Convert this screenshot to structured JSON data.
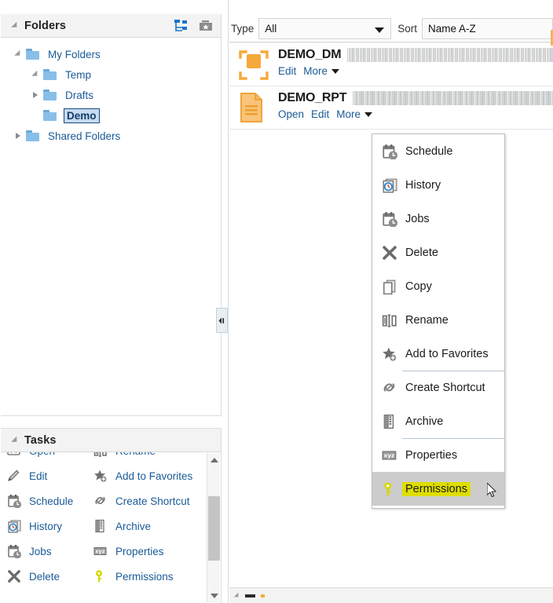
{
  "folders_panel": {
    "title": "Folders",
    "disclosure_icon": "triangle-down-icon",
    "actions": [
      {
        "name": "tree-view-icon",
        "label": "Tree View"
      },
      {
        "name": "favorites-folder-icon",
        "label": "Favorites"
      }
    ],
    "tree": [
      {
        "label": "My Folders",
        "depth": 0,
        "twisty": "open",
        "selected": false
      },
      {
        "label": "Temp",
        "depth": 1,
        "twisty": "open",
        "selected": false
      },
      {
        "label": "Drafts",
        "depth": 1,
        "twisty": "closed",
        "selected": false
      },
      {
        "label": "Demo",
        "depth": 1,
        "twisty": "none",
        "selected": true
      },
      {
        "label": "Shared Folders",
        "depth": 0,
        "twisty": "closed",
        "selected": false
      }
    ]
  },
  "tasks_panel": {
    "title": "Tasks",
    "disclosure_icon": "triangle-down-icon",
    "items": [
      {
        "label": "Open",
        "icon": "open-icon"
      },
      {
        "label": "Rename",
        "icon": "rename-icon"
      },
      {
        "label": "Edit",
        "icon": "pencil-icon"
      },
      {
        "label": "Add to Favorites",
        "icon": "star-plus-icon"
      },
      {
        "label": "Schedule",
        "icon": "calendar-clock-icon"
      },
      {
        "label": "Create Shortcut",
        "icon": "link-icon"
      },
      {
        "label": "History",
        "icon": "history-clock-icon"
      },
      {
        "label": "Archive",
        "icon": "archive-icon"
      },
      {
        "label": "Jobs",
        "icon": "calendar-clock-icon"
      },
      {
        "label": "Properties",
        "icon": "xyz-properties-icon"
      },
      {
        "label": "Delete",
        "icon": "x-delete-icon"
      },
      {
        "label": "Permissions",
        "icon": "key-icon"
      }
    ]
  },
  "splitter": {
    "handle_icon": "collapse-left-handle-icon"
  },
  "toolbar": {
    "type_label": "Type",
    "type_value": "All",
    "sort_label": "Sort",
    "sort_value": "Name A-Z"
  },
  "item_list": [
    {
      "name": "DEMO_DM",
      "icon": "data-model-icon",
      "actions": [
        {
          "label": "Edit",
          "name": "edit-link"
        },
        {
          "label": "More",
          "name": "more-link",
          "has_caret": true
        }
      ]
    },
    {
      "name": "DEMO_RPT",
      "icon": "report-document-icon",
      "actions": [
        {
          "label": "Open",
          "name": "open-link"
        },
        {
          "label": "Edit",
          "name": "edit-link"
        },
        {
          "label": "More",
          "name": "more-link",
          "has_caret": true
        }
      ]
    }
  ],
  "context_menu": {
    "items": [
      {
        "label": "Schedule",
        "icon": "calendar-clock-icon",
        "separator_above": false,
        "highlighted": false
      },
      {
        "label": "History",
        "icon": "history-clock-icon",
        "separator_above": false,
        "highlighted": false
      },
      {
        "label": "Jobs",
        "icon": "calendar-clock-icon",
        "separator_above": false,
        "highlighted": false
      },
      {
        "label": "Delete",
        "icon": "x-delete-icon",
        "separator_above": false,
        "highlighted": false
      },
      {
        "label": "Copy",
        "icon": "copy-icon",
        "separator_above": false,
        "highlighted": false
      },
      {
        "label": "Rename",
        "icon": "rename-icon",
        "separator_above": false,
        "highlighted": false
      },
      {
        "label": "Add to Favorites",
        "icon": "star-plus-icon",
        "separator_above": false,
        "highlighted": false
      },
      {
        "label": "Create Shortcut",
        "icon": "link-icon",
        "separator_above": true,
        "highlighted": false
      },
      {
        "label": "Archive",
        "icon": "archive-icon",
        "separator_above": false,
        "highlighted": false
      },
      {
        "label": "Properties",
        "icon": "xyz-properties-icon",
        "separator_above": true,
        "highlighted": false
      },
      {
        "label": "Permissions",
        "icon": "key-icon",
        "separator_above": false,
        "highlighted": true
      }
    ]
  },
  "cursor": {
    "icon": "mouse-pointer-icon"
  },
  "colors": {
    "accent_blue": "#1a5a96",
    "highlight_yellow": "#dede00",
    "highlight_row_gray": "#cccccc",
    "icon_orange": "#f6a93b",
    "selected_tree_bg": "#c6dbef"
  }
}
